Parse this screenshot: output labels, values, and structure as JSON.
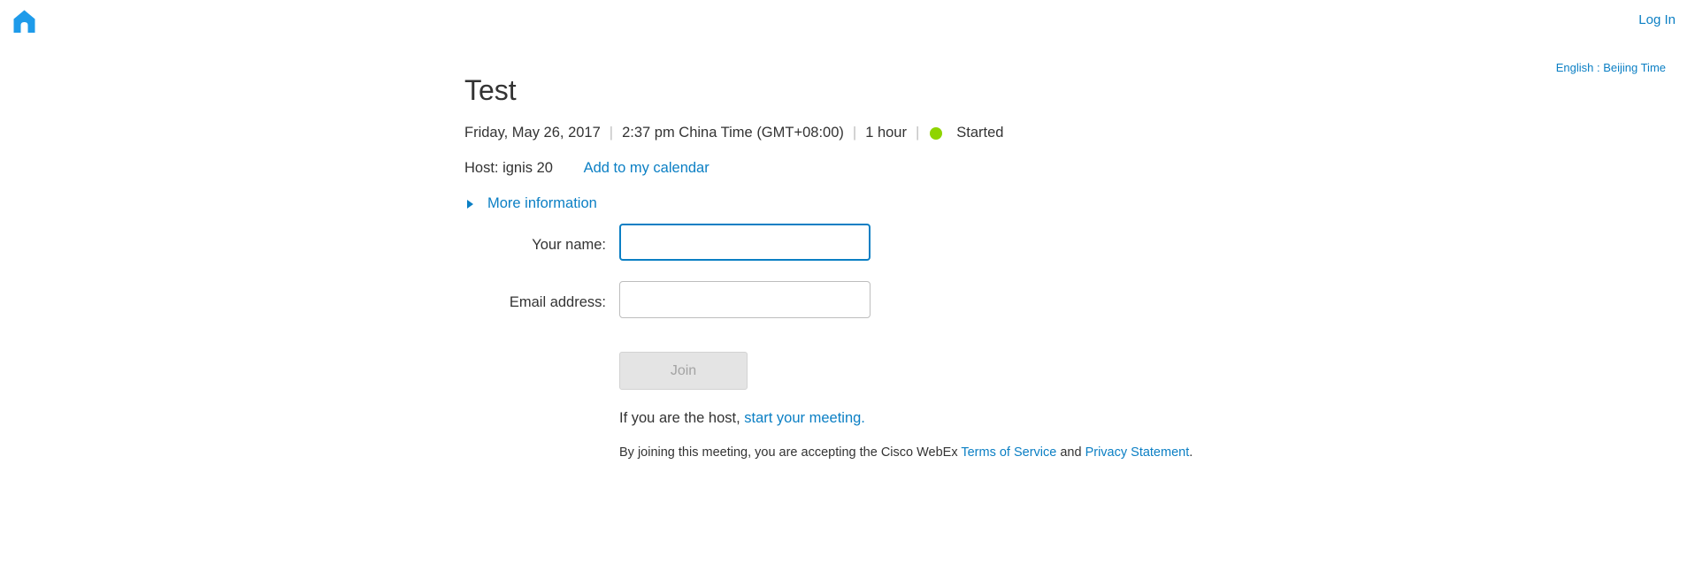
{
  "header": {
    "home_icon": "home-icon",
    "login_label": "Log In",
    "locale_label": "English : Beijing Time"
  },
  "meeting": {
    "title": "Test",
    "date": "Friday, May 26, 2017",
    "time": "2:37 pm China Time (GMT+08:00)",
    "duration": "1 hour",
    "status": "Started",
    "status_color": "#8fd400",
    "host_label": "Host: ignis 20",
    "calendar_label": "Add to my calendar",
    "more_info_label": "More information"
  },
  "form": {
    "name_label": "Your name:",
    "name_value": "",
    "email_label": "Email address:",
    "email_value": "",
    "join_label": "Join"
  },
  "footer": {
    "host_prefix": "If you are the host, ",
    "host_link": "start your meeting.",
    "terms_prefix": "By joining this meeting, you are accepting the Cisco WebEx ",
    "terms_link": "Terms of Service",
    "terms_and": " and ",
    "privacy_link": "Privacy Statement",
    "terms_suffix": "."
  },
  "colors": {
    "link": "#0b7fc4",
    "home_icon": "#1e9bea"
  }
}
